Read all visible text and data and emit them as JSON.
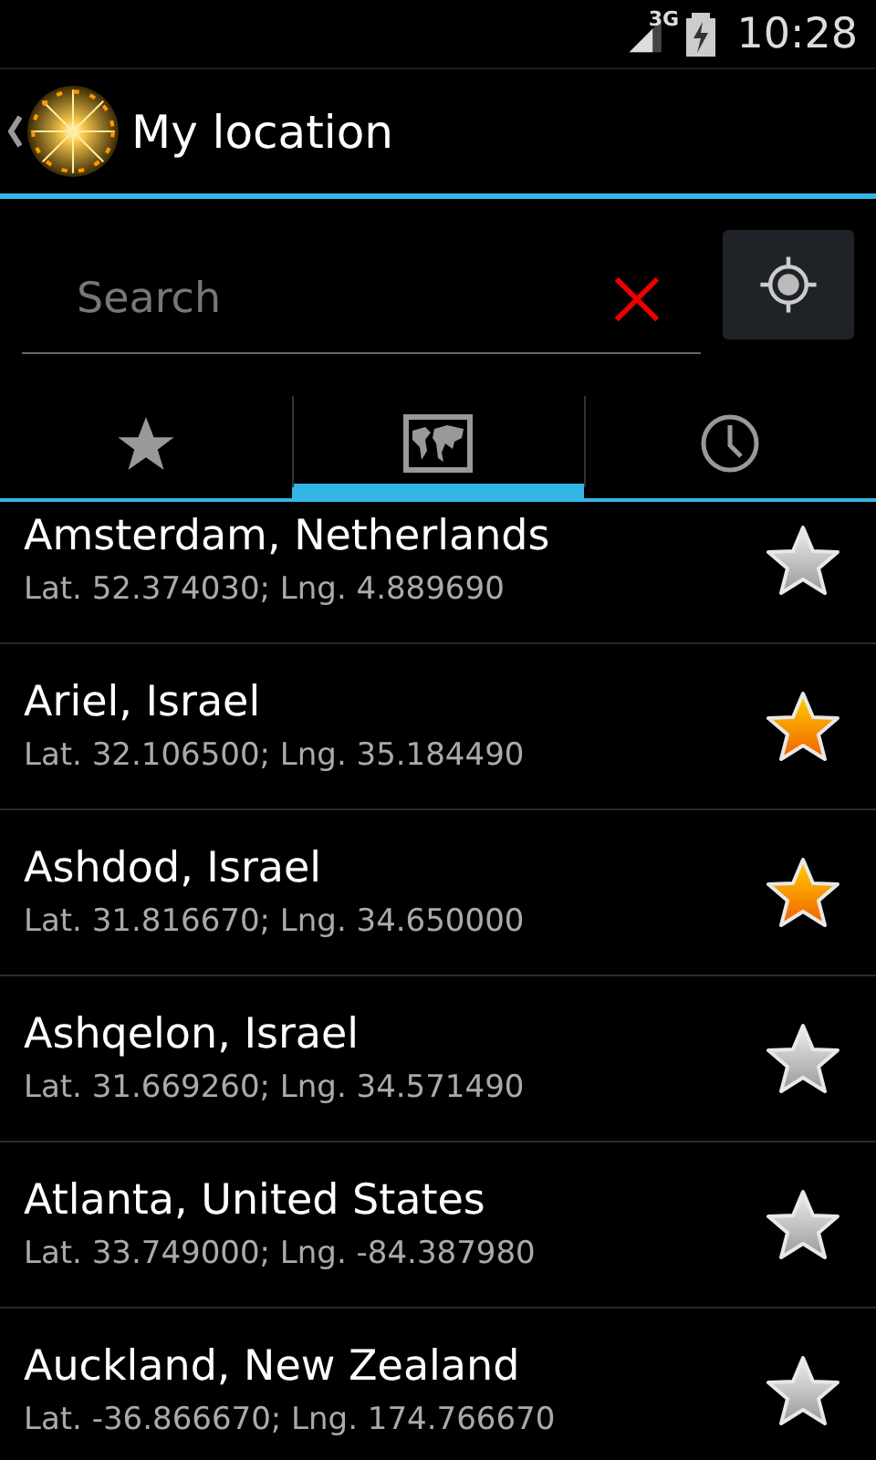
{
  "status_bar": {
    "network": "3G",
    "time": "10:28"
  },
  "action_bar": {
    "title": "My location"
  },
  "search": {
    "placeholder": "Search"
  },
  "tabs": [
    {
      "kind": "star",
      "selected": false
    },
    {
      "kind": "map",
      "selected": true
    },
    {
      "kind": "clock",
      "selected": false
    }
  ],
  "locations": [
    {
      "name": "Amsterdam, Netherlands",
      "coords": "Lat. 52.374030; Lng. 4.889690",
      "favorite": false
    },
    {
      "name": "Ariel, Israel",
      "coords": "Lat. 32.106500; Lng. 35.184490",
      "favorite": true
    },
    {
      "name": "Ashdod, Israel",
      "coords": "Lat. 31.816670; Lng. 34.650000",
      "favorite": true
    },
    {
      "name": "Ashqelon, Israel",
      "coords": "Lat. 31.669260; Lng. 34.571490",
      "favorite": false
    },
    {
      "name": "Atlanta, United States",
      "coords": "Lat. 33.749000; Lng. -84.387980",
      "favorite": false
    },
    {
      "name": "Auckland, New Zealand",
      "coords": "Lat. -36.866670; Lng. 174.766670",
      "favorite": false
    }
  ]
}
